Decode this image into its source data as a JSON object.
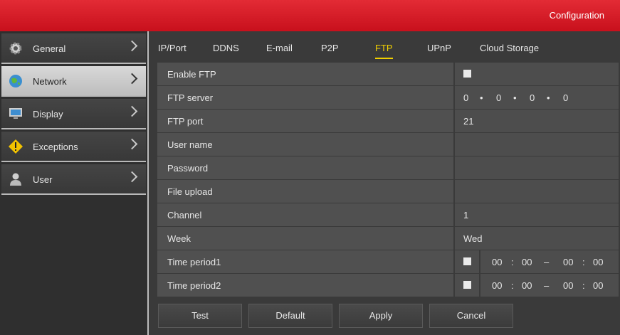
{
  "header": {
    "title": "Configuration"
  },
  "sidebar": {
    "items": [
      {
        "label": "General",
        "icon": "gear-icon"
      },
      {
        "label": "Network",
        "icon": "globe-icon"
      },
      {
        "label": "Display",
        "icon": "monitor-icon"
      },
      {
        "label": "Exceptions",
        "icon": "warning-icon"
      },
      {
        "label": "User",
        "icon": "user-icon"
      }
    ],
    "active": "Network"
  },
  "tabs": [
    "IP/Port",
    "DDNS",
    "E-mail",
    "P2P",
    "FTP",
    "UPnP",
    "Cloud Storage"
  ],
  "active_tab": "FTP",
  "form": {
    "enable_ftp": {
      "label": "Enable FTP",
      "checked": false
    },
    "ftp_server": {
      "label": "FTP server",
      "octets": [
        "0",
        "0",
        "0",
        "0"
      ],
      "separator": "•"
    },
    "ftp_port": {
      "label": "FTP port",
      "value": "21"
    },
    "user_name": {
      "label": "User name",
      "value": ""
    },
    "password": {
      "label": "Password",
      "value": ""
    },
    "file_upload": {
      "label": "File upload",
      "value": ""
    },
    "channel": {
      "label": "Channel",
      "value": "1"
    },
    "week": {
      "label": "Week",
      "value": "Wed"
    },
    "time_period1": {
      "label": "Time period1",
      "checked": false,
      "start_h": "00",
      "start_m": "00",
      "end_h": "00",
      "end_m": "00"
    },
    "time_period2": {
      "label": "Time period2",
      "checked": false,
      "start_h": "00",
      "start_m": "00",
      "end_h": "00",
      "end_m": "00"
    },
    "time_colon": ":",
    "time_dash": "–"
  },
  "buttons": {
    "test": "Test",
    "default": "Default",
    "apply": "Apply",
    "cancel": "Cancel"
  },
  "colors": {
    "header": "#d51a25",
    "active_tab": "#f1d000",
    "panel": "#3a3a3a"
  }
}
